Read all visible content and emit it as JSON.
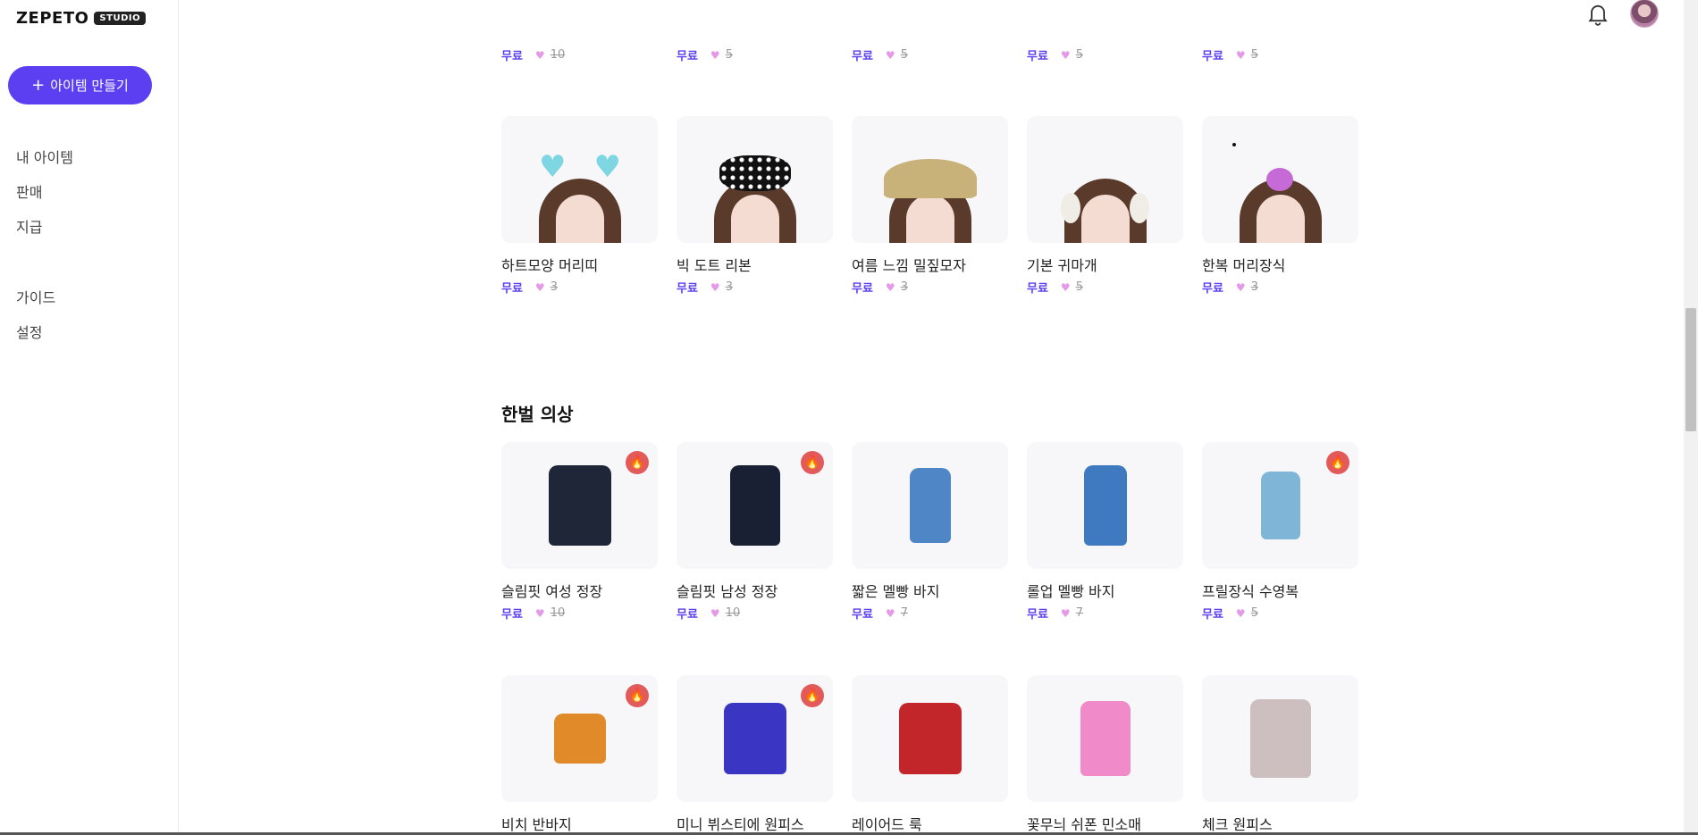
{
  "app": {
    "logo_text": "ZEPETO",
    "logo_badge": "STUDIO"
  },
  "sidebar": {
    "create_label": "아이템 만들기",
    "nav_group1": [
      "내 아이템",
      "판매",
      "지급"
    ],
    "nav_group2": [
      "가이드",
      "설정"
    ]
  },
  "colors": {
    "accent": "#5b3ff0",
    "hot_badge": "#e35a5a",
    "gem": "#e59ae8"
  },
  "partial_row": [
    {
      "free": "무료",
      "old": "10"
    },
    {
      "free": "무료",
      "old": "5"
    },
    {
      "free": "무료",
      "old": "5"
    },
    {
      "free": "무료",
      "old": "5"
    },
    {
      "free": "무료",
      "old": "5"
    }
  ],
  "accessories": [
    {
      "name": "하트모양 머리띠",
      "free": "무료",
      "old": "3",
      "icon": "heart-headband"
    },
    {
      "name": "빅 도트 리본",
      "free": "무료",
      "old": "3",
      "icon": "dot-ribbon"
    },
    {
      "name": "여름 느낌 밀짚모자",
      "free": "무료",
      "old": "3",
      "icon": "straw-hat"
    },
    {
      "name": "기본 귀마개",
      "free": "무료",
      "old": "5",
      "icon": "earmuffs"
    },
    {
      "name": "한복 머리장식",
      "free": "무료",
      "old": "3",
      "icon": "hanbok-hairpin"
    }
  ],
  "outfit_section_title": "한벌 의상",
  "outfits": [
    {
      "name": "슬림핏 여성 정장",
      "free": "무료",
      "old": "10",
      "hot": true,
      "color": "#1f2638"
    },
    {
      "name": "슬림핏 남성 정장",
      "free": "무료",
      "old": "10",
      "hot": true,
      "color": "#1a2033"
    },
    {
      "name": "짧은 멜빵 바지",
      "free": "무료",
      "old": "7",
      "hot": false,
      "color": "#4f86c6"
    },
    {
      "name": "롤업 멜빵 바지",
      "free": "무료",
      "old": "7",
      "hot": false,
      "color": "#3f7ac0"
    },
    {
      "name": "프릴장식 수영복",
      "free": "무료",
      "old": "5",
      "hot": true,
      "color": "#7fb6d8"
    }
  ],
  "outfits2": [
    {
      "name": "비치 반바지",
      "hot": true,
      "color": "#e08a2a"
    },
    {
      "name": "미니 뷔스티에 원피스",
      "hot": true,
      "color": "#3b35c4"
    },
    {
      "name": "레이어드 룩",
      "hot": false,
      "color": "#c2262b"
    },
    {
      "name": "꽃무늬 쉬폰 민소매",
      "hot": false,
      "color": "#f08ac8"
    },
    {
      "name": "체크 원피스",
      "hot": false,
      "color": "#cdbfc0"
    }
  ]
}
